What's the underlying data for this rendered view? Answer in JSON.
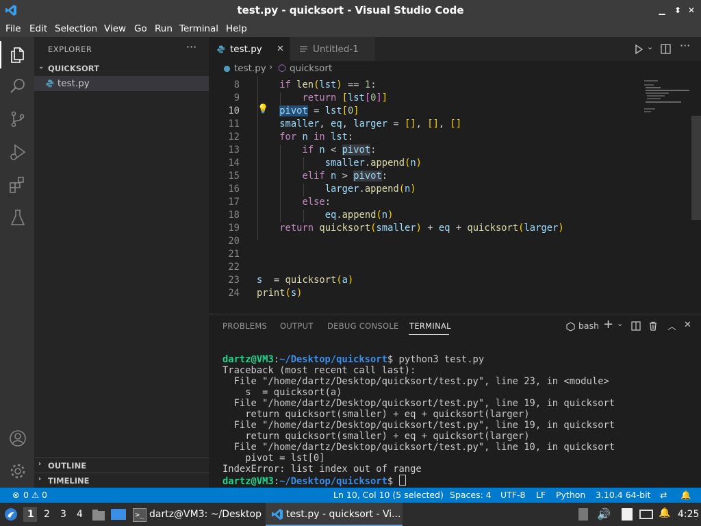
{
  "window": {
    "title": "test.py - quicksort - Visual Studio Code"
  },
  "menu": [
    "File",
    "Edit",
    "Selection",
    "View",
    "Go",
    "Run",
    "Terminal",
    "Help"
  ],
  "sidebar": {
    "header": "EXPLORER",
    "more": "···",
    "folder": "QUICKSORT",
    "file": "test.py",
    "outline": "OUTLINE",
    "timeline": "TIMELINE"
  },
  "tabs": [
    {
      "label": "test.py",
      "close": "✕",
      "active": true
    },
    {
      "label": "Untitled-1",
      "active": false
    }
  ],
  "breadcrumb": {
    "file": "test.py",
    "symbol": "quicksort"
  },
  "editor": {
    "line_numbers": [
      "8",
      "9",
      "10",
      "11",
      "12",
      "13",
      "14",
      "15",
      "16",
      "17",
      "18",
      "19",
      "20",
      "21",
      "22",
      "23",
      "24"
    ],
    "current_line": "10"
  },
  "panel": {
    "tabs": [
      "PROBLEMS",
      "OUTPUT",
      "DEBUG CONSOLE",
      "TERMINAL"
    ],
    "shell": "bash",
    "prompt_user": "dartz@VM3",
    "prompt_path": "~/Desktop/quicksort",
    "command": "python3 test.py",
    "output": [
      "Traceback (most recent call last):",
      "  File \"/home/dartz/Desktop/quicksort/test.py\", line 23, in <module>",
      "    s  = quicksort(a)",
      "  File \"/home/dartz/Desktop/quicksort/test.py\", line 19, in quicksort",
      "    return quicksort(smaller) + eq + quicksort(larger)",
      "  File \"/home/dartz/Desktop/quicksort/test.py\", line 19, in quicksort",
      "    return quicksort(smaller) + eq + quicksort(larger)",
      "  File \"/home/dartz/Desktop/quicksort/test.py\", line 10, in quicksort",
      "    pivot = lst[0]",
      "IndexError: list index out of range"
    ]
  },
  "statusbar": {
    "errors": "0",
    "warnings": "0",
    "cursor": "Ln 10, Col 10 (5 selected)",
    "spaces": "Spaces: 4",
    "encoding": "UTF-8",
    "eol": "LF",
    "language": "Python",
    "interpreter": "3.10.4 64-bit"
  },
  "taskbar": {
    "workspaces": [
      "1",
      "2",
      "3",
      "4"
    ],
    "terminal_task": "dartz@VM3: ~/Desktop",
    "vscode_task": "test.py - quicksort - Vi...",
    "clock": "4:25"
  },
  "colors": {
    "accent": "#007acc",
    "titlebar": "#3c3c3c",
    "sidebar": "#252526",
    "editor": "#1e1e1e"
  }
}
